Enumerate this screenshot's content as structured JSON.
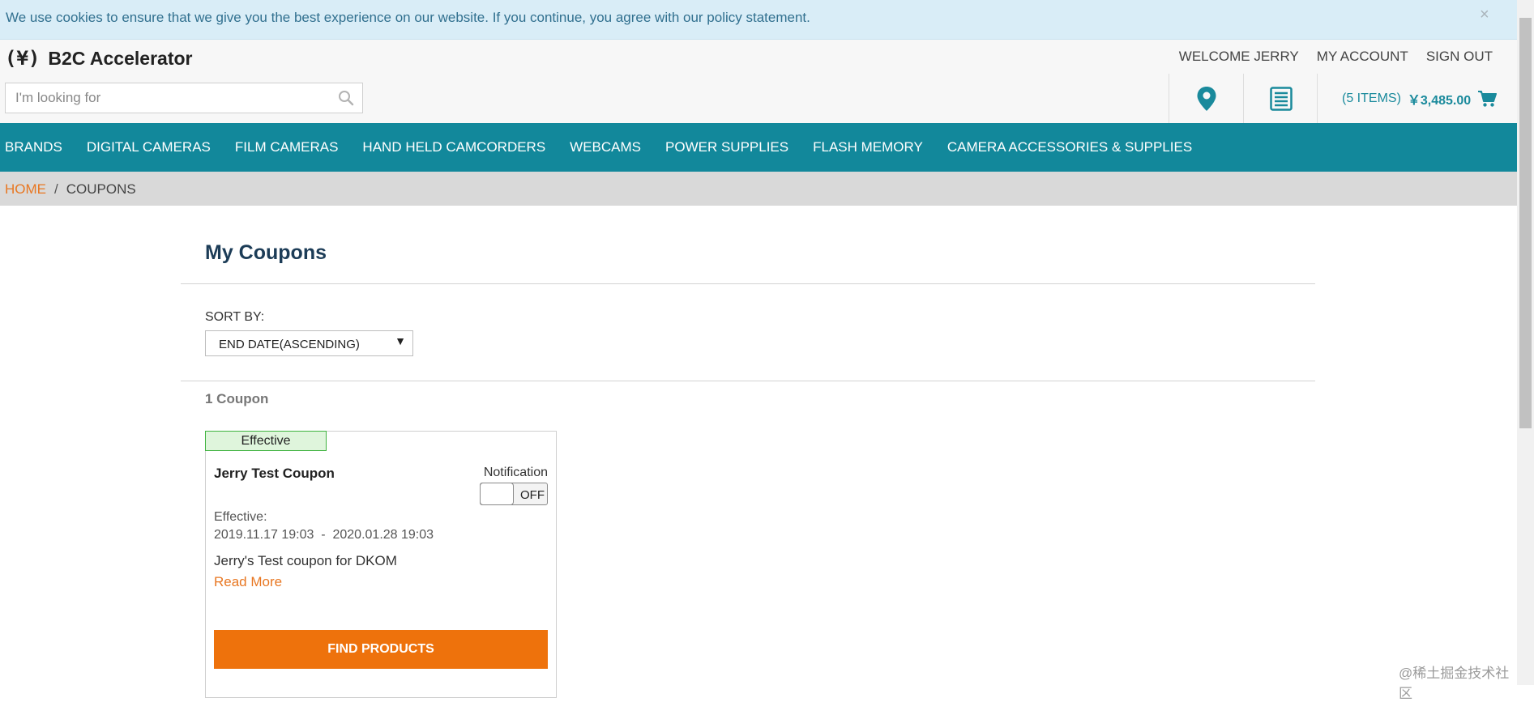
{
  "cookie_banner": {
    "text": "We use cookies to ensure that we give you the best experience on our website. If you continue, you agree with our policy statement.",
    "close_glyph": "×"
  },
  "header": {
    "logo_mark": "(¥)",
    "logo_text": "B2C Accelerator",
    "links": [
      "WELCOME JERRY",
      "MY ACCOUNT",
      "SIGN OUT"
    ]
  },
  "search": {
    "placeholder": "I'm looking for",
    "icon": "search-icon"
  },
  "utility": {
    "store_icon": "map-pin-icon",
    "quick_order_icon": "list-icon",
    "cart": {
      "count_text": "(5 ITEMS)",
      "total": "￥3,485.00",
      "icon": "cart-icon"
    }
  },
  "nav": {
    "items": [
      "BRANDS",
      "DIGITAL CAMERAS",
      "FILM CAMERAS",
      "HAND HELD CAMCORDERS",
      "WEBCAMS",
      "POWER SUPPLIES",
      "FLASH MEMORY",
      "CAMERA ACCESSORIES & SUPPLIES"
    ]
  },
  "breadcrumb": {
    "home": "HOME",
    "separator": "/",
    "current": "COUPONS"
  },
  "main": {
    "title": "My Coupons",
    "sort_label": "SORT BY:",
    "sort_value": "END DATE(ASCENDING)",
    "coupon_count": "1 Coupon"
  },
  "coupon": {
    "status": "Effective",
    "name": "Jerry Test Coupon",
    "notification_label": "Notification",
    "toggle_state": "OFF",
    "effective_label": "Effective:",
    "effective_dates": "2019.11.17 19:03  -  2020.01.28 19:03",
    "description": "Jerry's Test coupon for DKOM",
    "read_more": "Read More",
    "button": "FIND PRODUCTS"
  },
  "watermark": "@稀土掘金技术社区",
  "colors": {
    "nav_bg": "#12889b",
    "accent_orange": "#ee720c",
    "link_orange": "#e87722",
    "teal_text": "#1a8a9c",
    "cookie_bg": "#d9edf7",
    "badge_bg": "#dff5dc",
    "badge_border": "#3fb33f",
    "title_color": "#1c3c57"
  }
}
